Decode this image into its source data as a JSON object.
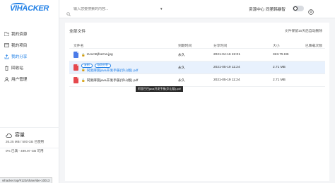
{
  "app": {
    "logo_text": "VIHACKER"
  },
  "header": {
    "search_placeholder": "输入您要搜索的内容...",
    "links": {
      "resources": "资源中心",
      "user": "同第韩暴智"
    }
  },
  "sidebar": {
    "items": [
      {
        "label": "我的资源",
        "icon": "folder-icon"
      },
      {
        "label": "我的项目",
        "icon": "project-icon"
      },
      {
        "label": "我的分享",
        "icon": "share-icon",
        "active": true
      },
      {
        "label": "回收站",
        "icon": "trash-icon"
      },
      {
        "label": "用户管理",
        "icon": "users-icon"
      }
    ],
    "quota": {
      "title": "容量",
      "used_line": "26.25 MB / 500 GB 已使用",
      "free_line": "0% 已满 - 499.97 GB 可用",
      "used_fraction": 0.0
    }
  },
  "main": {
    "title": "全部文件",
    "hint": "文件保留15天后自动删除",
    "columns": [
      "文件名",
      "到期时间",
      "分享时间",
      "大小",
      "已降载次数"
    ],
    "rows": [
      {
        "name": "nUoABjfseCw.jpg",
        "type": "jpg",
        "expire": "永久",
        "shared": "2021-04-16 22:01",
        "size": "323.75 KB",
        "downloads": ""
      },
      {
        "name": "同宴麻施java开发手册(华山版).pdf",
        "type": "pdf",
        "expire": "永久",
        "shared": "2021-05-19 11:24",
        "size": "2.71 MB",
        "downloads": "",
        "selected": true,
        "actions": [
          "复制",
          "取消分享"
        ]
      },
      {
        "name": "同宴麻施java开发手册(华山版).pdf",
        "type": "pdf",
        "expire": "永久",
        "shared": "2021-05-19 11:24",
        "size": "2.71 MB",
        "downloads": ""
      }
    ],
    "tooltip": "阿里巴巴java开发手册(华山版).pdf"
  },
  "status_url": "vihacker.top/#123/share/ide-10013",
  "colors": {
    "accent": "#1f7fe6",
    "pdf": "#e5484d",
    "jpg": "#4b7be8",
    "selected_row": "#e8f1fd"
  }
}
